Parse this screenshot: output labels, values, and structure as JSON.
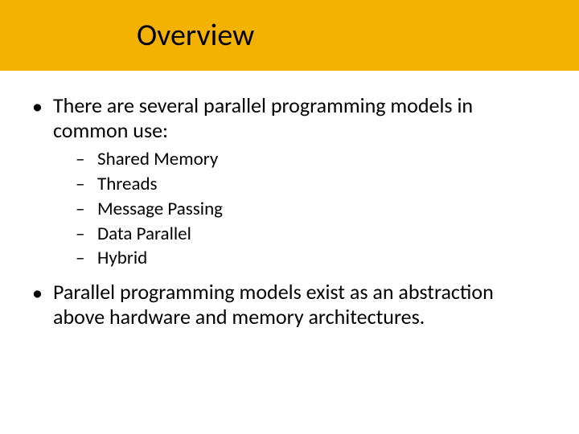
{
  "title": "Overview",
  "bullets": [
    {
      "text": "There are several parallel programming models in common use:",
      "sub": [
        "Shared Memory",
        "Threads",
        "Message Passing",
        "Data Parallel",
        "Hybrid"
      ]
    },
    {
      "text": "Parallel programming models exist as an abstraction above hardware and memory architectures.",
      "sub": []
    }
  ]
}
